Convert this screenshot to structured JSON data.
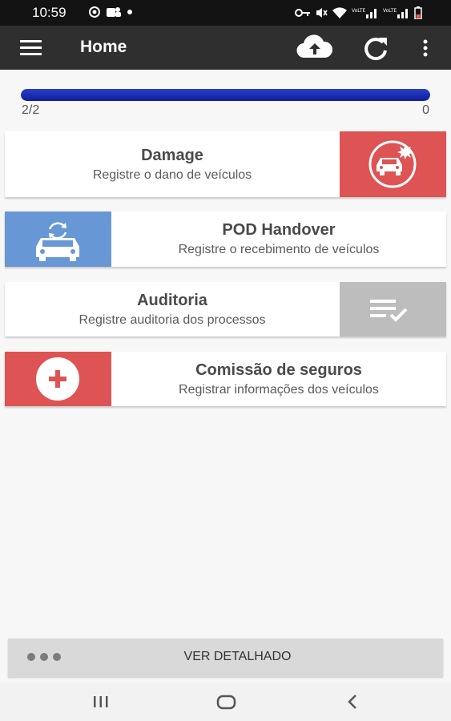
{
  "status_bar": {
    "time": "10:59",
    "left_icons": [
      "at-sign-icon",
      "teams-icon",
      "dot-icon"
    ],
    "right_icons": [
      "key-icon",
      "mute-icon",
      "wifi-icon",
      "signal-icon",
      "signal-icon",
      "battery-icon"
    ]
  },
  "app_bar": {
    "title": "Home",
    "icons": [
      "menu-icon",
      "cloud-upload-icon",
      "refresh-icon",
      "more-vert-icon"
    ]
  },
  "progress": {
    "left_label": "2/2",
    "right_label": "0",
    "fraction": 1.0,
    "color": "#1a2db0"
  },
  "cards": [
    {
      "title": "Damage",
      "subtitle": "Registre o dano de veículos",
      "icon": "car-crash-icon",
      "icon_bg": "#de5353"
    },
    {
      "title": "POD Handover",
      "subtitle": "Registre o recebimento de veículos",
      "icon": "car-handover-icon",
      "icon_bg": "#6897d6"
    },
    {
      "title": "Auditoria",
      "subtitle": "Registre auditoria dos processos",
      "icon": "checklist-icon",
      "icon_bg": "#bdbdbd"
    },
    {
      "title": "Comissão de seguros",
      "subtitle": "Registrar informações dos veículos",
      "icon": "add-circle-icon",
      "icon_bg": "#de5353"
    }
  ],
  "detail_bar": {
    "label": "VER DETALHADO",
    "icon": "more-horiz-icon"
  },
  "nav_bar": {
    "icons": [
      "recents-icon",
      "home-icon",
      "back-icon"
    ]
  }
}
